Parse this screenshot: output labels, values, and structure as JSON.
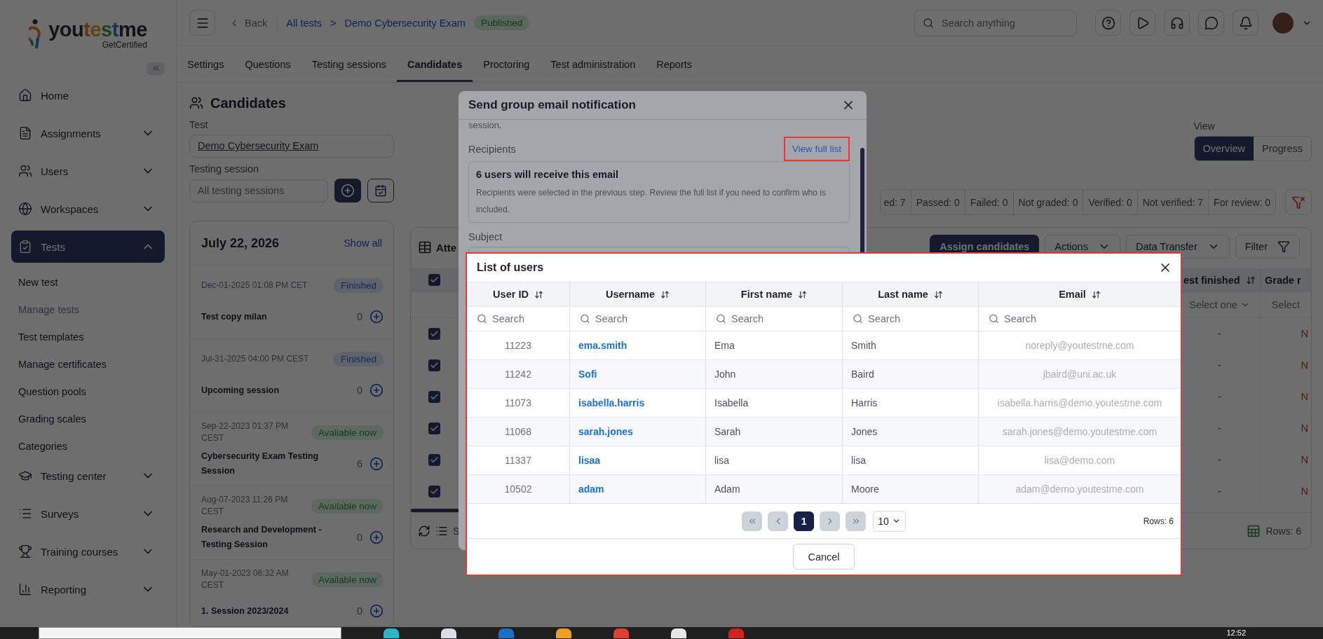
{
  "sidebar": {
    "brand": "youtestme",
    "tagline": "GetCertified",
    "items": [
      {
        "label": "Home",
        "selected": false
      },
      {
        "label": "Assignments",
        "expandable": true,
        "expanded": false,
        "selected": false
      },
      {
        "label": "Users",
        "expandable": true,
        "expanded": false,
        "selected": false
      },
      {
        "label": "Workspaces",
        "expandable": true,
        "expanded": false,
        "selected": false
      },
      {
        "label": "Tests",
        "expandable": true,
        "expanded": true,
        "selected": true,
        "children": [
          {
            "label": "New test",
            "selected": false
          },
          {
            "label": "Manage tests",
            "selected": true
          },
          {
            "label": "Test templates",
            "selected": false
          },
          {
            "label": "Manage certificates",
            "selected": false
          },
          {
            "label": "Question pools",
            "selected": false
          },
          {
            "label": "Grading scales",
            "selected": false
          },
          {
            "label": "Categories",
            "selected": false
          }
        ]
      },
      {
        "label": "Testing center",
        "expandable": true,
        "expanded": false,
        "selected": false
      },
      {
        "label": "Surveys",
        "expandable": true,
        "expanded": false,
        "selected": false
      },
      {
        "label": "Training courses",
        "expandable": true,
        "expanded": false,
        "selected": false
      },
      {
        "label": "Reporting",
        "expandable": true,
        "expanded": false,
        "selected": false
      }
    ]
  },
  "topbar": {
    "back": "Back",
    "breadcrumb": [
      "All tests",
      "Demo Cybersecurity Exam"
    ],
    "separator": ">",
    "status": "Published",
    "search": {
      "placeholder": "Search anything"
    }
  },
  "tabs": [
    {
      "label": "Settings",
      "selected": false
    },
    {
      "label": "Questions",
      "selected": false
    },
    {
      "label": "Testing sessions",
      "selected": false
    },
    {
      "label": "Candidates",
      "selected": true
    },
    {
      "label": "Proctoring",
      "selected": false
    },
    {
      "label": "Test administration",
      "selected": false
    },
    {
      "label": "Reports",
      "selected": false
    }
  ],
  "candidates": {
    "title": "Candidates",
    "test_label": "Test",
    "test_value": "Demo Cybersecurity Exam",
    "session_label": "Testing session",
    "session_placeholder": "All testing sessions"
  },
  "sessions": {
    "date": "July 22, 2026",
    "show_all": "Show all",
    "items": [
      {
        "datetime": "Dec-01-2025 01:08 PM CET",
        "status": "Finished",
        "kind": "finished",
        "name": "Test copy milan",
        "count": "0"
      },
      {
        "datetime": "Jul-31-2025 04:00 PM CEST",
        "status": "Finished",
        "kind": "finished",
        "name": "Upcoming session",
        "count": "0"
      },
      {
        "datetime": "Sep-22-2023 01:37 PM CEST",
        "status": "Available now",
        "kind": "available",
        "name": "Cybersecurity Exam Testing Session",
        "count": "6"
      },
      {
        "datetime": "Aug-07-2023 11:26 PM CEST",
        "status": "Available now",
        "kind": "available",
        "name": "Research and Development - Testing Session",
        "count": "0"
      },
      {
        "datetime": "May-01-2023 06:32 AM CEST",
        "status": "Available now",
        "kind": "available",
        "name": "1. Session 2023/2024",
        "count": "0"
      }
    ]
  },
  "view": {
    "label": "View",
    "options": [
      {
        "label": "Overview",
        "selected": true
      },
      {
        "label": "Progress",
        "selected": false
      }
    ]
  },
  "stats": [
    "ed: 7",
    "Passed: 0",
    "Failed: 0",
    "Not graded: 0",
    "Verified: 0",
    "Not verified: 7",
    "For review: 0"
  ],
  "attempts": {
    "title": "Atte",
    "buttons": [
      {
        "label": "Assign candidates",
        "kind": "primary"
      },
      {
        "label": "Actions",
        "kind": "dropdown"
      },
      {
        "label": "Data Transfer",
        "kind": "dropdown"
      },
      {
        "label": "Filter",
        "kind": "filter"
      }
    ],
    "header_checked": true,
    "columns": [
      {
        "label": "est finished",
        "filter": "Select one"
      },
      {
        "label": "Grade r",
        "filter": "Select"
      }
    ],
    "rows": [
      {
        "checked": true,
        "cells": [
          "-",
          "N"
        ]
      },
      {
        "checked": true,
        "cells": [
          "-",
          "N"
        ]
      },
      {
        "checked": true,
        "cells": [
          "-",
          "N"
        ]
      },
      {
        "checked": true,
        "cells": [
          "-",
          "N"
        ]
      },
      {
        "checked": true,
        "cells": [
          "-",
          "N"
        ]
      },
      {
        "checked": true,
        "cells": [
          "-",
          "N"
        ]
      }
    ],
    "footer_text": "S",
    "rows_count": "Rows: 6"
  },
  "email_dialog": {
    "title": "Send group email notification",
    "intro": "session.",
    "recipients_label": "Recipients",
    "view_full_list": "View full list",
    "summary_title": "6 users will receive this email",
    "summary_text": "Recipients were selected in the previous step. Review the full list if you need to confirm who is included.",
    "subject_label": "Subject"
  },
  "users_dialog": {
    "title": "List of users",
    "columns": [
      {
        "label": "User ID",
        "placeholder": "Search"
      },
      {
        "label": "Username",
        "placeholder": "Search"
      },
      {
        "label": "First name",
        "placeholder": "Search"
      },
      {
        "label": "Last name",
        "placeholder": "Search"
      },
      {
        "label": "Email",
        "placeholder": "Search"
      }
    ],
    "rows": [
      {
        "user_id": "11223",
        "username": "ema.smith",
        "first_name": "Ema",
        "last_name": "Smith",
        "email": "noreply@youtestme.com"
      },
      {
        "user_id": "11242",
        "username": "Sofi",
        "first_name": "John",
        "last_name": "Baird",
        "email": "jbaird@uni.ac.uk"
      },
      {
        "user_id": "11073",
        "username": "isabella.harris",
        "first_name": "Isabella",
        "last_name": "Harris",
        "email": "isabella.harris@demo.youtestme.com"
      },
      {
        "user_id": "11068",
        "username": "sarah.jones",
        "first_name": "Sarah",
        "last_name": "Jones",
        "email": "sarah.jones@demo.youtestme.com"
      },
      {
        "user_id": "11337",
        "username": "lisaa",
        "first_name": "lisa",
        "last_name": "lisa",
        "email": "lisa@demo.com"
      },
      {
        "user_id": "10502",
        "username": "adam",
        "first_name": "Adam",
        "last_name": "Moore",
        "email": "adam@demo.youtestme.com"
      }
    ],
    "pagination": {
      "can_go_back": false,
      "can_go_forward": false,
      "pages": [
        {
          "label": "1",
          "selected": true
        }
      ],
      "page_size": "10",
      "rows_count": "Rows: 6"
    },
    "cancel": "Cancel"
  },
  "taskbar": {
    "time": "12:52"
  }
}
